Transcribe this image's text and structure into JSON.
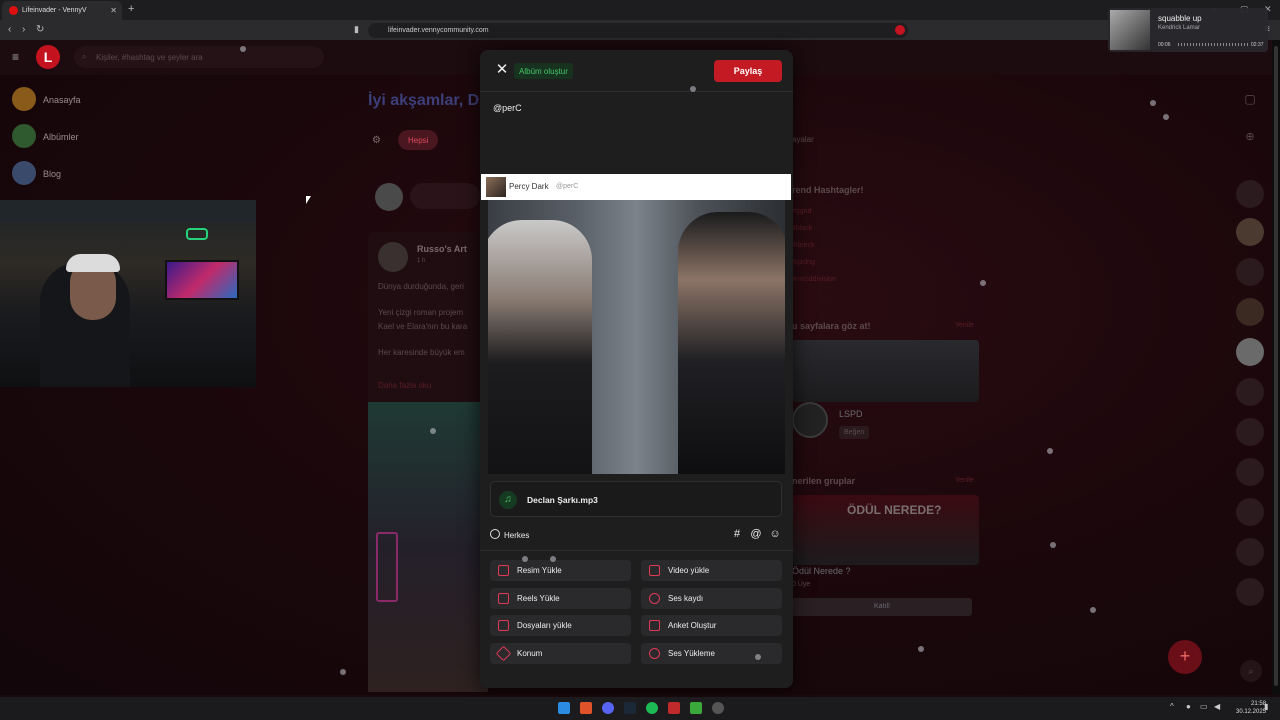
{
  "browser": {
    "tab_title": "Lifeinvader - VennyV",
    "url": "lifeinvader.vennycommunity.com"
  },
  "music": {
    "title": "squabble up",
    "artist": "Kendrick Lamar",
    "time_current": "00:06",
    "time_total": "02:37"
  },
  "site": {
    "logo": "L",
    "search_placeholder": "Kişiler, #hashtag ve şeyler ara",
    "sidebar": [
      {
        "label": "Anasayfa",
        "color": "#8a5a1a"
      },
      {
        "label": "Albümler",
        "color": "#2f5a2f"
      },
      {
        "label": "Blog",
        "color": "#3a4a6a"
      }
    ],
    "greeting": "İyi akşamlar, D",
    "filter_all": "Hepsi",
    "filter_other": "ayalar",
    "post_author": "Russo's Art",
    "post_time": "1 h",
    "post_line1": "Dünya durduğunda, geri",
    "post_line2": "Yeni çizgi roman projem",
    "post_line3": "Kael ve Elara'nın bu kara",
    "post_line4": "Her karesinde büyük em",
    "post_more": "Daha fazla oku",
    "trends_title": "rend Hashtagler!",
    "trends": [
      "#ggnd",
      "#black",
      "#ibreck",
      "#gzdng",
      "#mccddivision"
    ],
    "pages_title": "u sayfalara göz at!",
    "refresh": "Yenile",
    "lspd_name": "LSPD",
    "like": "Beğen",
    "groups_title": "nerilen gruplar",
    "group_title": "ÖDÜL NEREDE?",
    "group_name": "Ödül Nerede ?",
    "group_members": "0 Üye",
    "join": "Katıl!"
  },
  "modal": {
    "album_button": "Albüm oluştur",
    "share_button": "Paylaş",
    "post_text": "@perC",
    "mention_name": "Percy Dark",
    "mention_handle": "@perC",
    "audio_file": "Declan Şarkı.mp3",
    "audience": "Herkes",
    "actions": [
      {
        "label": "Resim Yükle",
        "icon": "image-icon"
      },
      {
        "label": "Video yükle",
        "icon": "video-icon"
      },
      {
        "label": "Reels Yükle",
        "icon": "reels-icon"
      },
      {
        "label": "Ses kaydı",
        "icon": "microphone-icon"
      },
      {
        "label": "Dosyaları yükle",
        "icon": "file-icon"
      },
      {
        "label": "Anket Oluştur",
        "icon": "poll-icon"
      },
      {
        "label": "Konum",
        "icon": "location-icon"
      },
      {
        "label": "Ses Yükleme",
        "icon": "music-icon"
      }
    ]
  },
  "taskbar": {
    "time": "21:58",
    "date": "30.12.2025"
  }
}
